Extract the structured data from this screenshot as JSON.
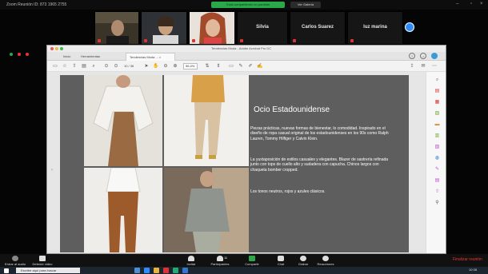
{
  "zoom": {
    "window_title": "Zoom   Reunión ID: 873 1965 2755",
    "share_banner": "Está compartiendo su pantalla",
    "view_button": "Ver Galería",
    "participants_tiles": [
      {
        "name": "",
        "type": "video"
      },
      {
        "name": "",
        "type": "video"
      },
      {
        "name": "",
        "type": "video"
      },
      {
        "name": "Silvia",
        "type": "name"
      },
      {
        "name": "Carlos Suarez",
        "type": "name"
      },
      {
        "name": "luz marina",
        "type": "name"
      }
    ],
    "bottom_controls": [
      {
        "label": "Entrar al audio",
        "icon": "mic-icon"
      },
      {
        "label": "Detener video",
        "icon": "video-icon"
      },
      {
        "label": "Invitar",
        "icon": "invite-icon"
      },
      {
        "label": "Participantes",
        "icon": "participants-icon",
        "count": "11"
      },
      {
        "label": "Compartir",
        "icon": "share-icon"
      },
      {
        "label": "Chat",
        "icon": "chat-icon"
      },
      {
        "label": "Grabar",
        "icon": "record-icon"
      },
      {
        "label": "Reacciones",
        "icon": "reactions-icon"
      }
    ],
    "end_meeting": "Finalizar reunión"
  },
  "browser": {
    "title_text": "Tendencias Moda - Adobe Acrobat Pro DC",
    "tabs": [
      {
        "label": "Inicio"
      },
      {
        "label": "Herramientas"
      },
      {
        "label": "Tendencias Moda ...  ×"
      }
    ],
    "toolbar": {
      "page_indicator": "10 / 36",
      "zoom_value": "56,4%"
    }
  },
  "slide": {
    "title": "Ocio Estadounidense",
    "paragraphs": [
      "Piezas prácticas, nuevas formas de bienestar, lo comodidad. Inspirado en el diseño de ropa casual original de los estadounidenses en los 90s como Ralph Lauren, Tommy Hilfiger y Calvin Klein.",
      "La yuxtaposición de estilos casuales y elegantes. Blazer de sastrería refinada junto con tops de cuello alto y sudadera con capucha. Chinos largos con chaqueta bomber cropped.",
      "Los tonos neutros, rojos y azules clásicos."
    ]
  },
  "taskbar": {
    "search_placeholder": "Escribe aquí para buscar",
    "time": "10:38"
  }
}
